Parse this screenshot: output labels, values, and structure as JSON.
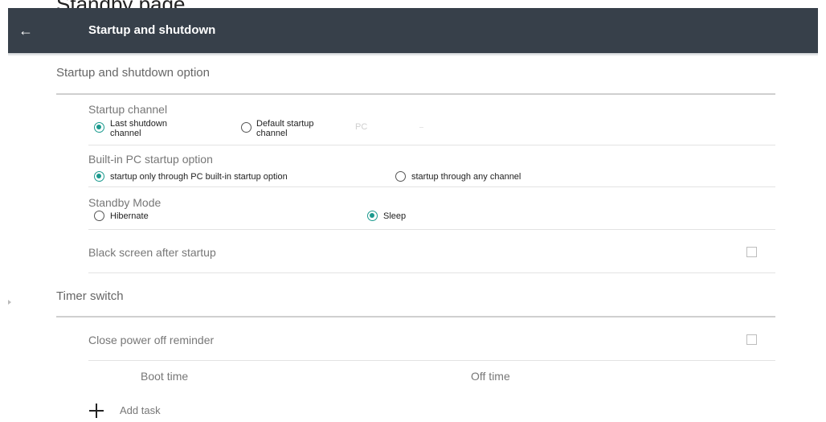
{
  "breadcrumb": "Standby page",
  "header": {
    "title": "Startup and shutdown",
    "back_icon": "arrow-left-icon"
  },
  "section_startup": {
    "title": "Startup and shutdown option"
  },
  "startup_channel": {
    "label": "Startup channel",
    "options": [
      {
        "line1": "Last shutdown",
        "line2": "channel",
        "selected": true
      },
      {
        "line1": "Default startup",
        "line2": "channel",
        "selected": false
      }
    ],
    "default_value": "PC"
  },
  "builtin_pc": {
    "label": "Built-in PC startup option",
    "options": [
      {
        "label": "startup only through PC built-in startup option",
        "selected": true
      },
      {
        "label": "startup through any channel",
        "selected": false
      }
    ]
  },
  "standby_mode": {
    "label": "Standby Mode",
    "options": [
      {
        "label": "Hibernate",
        "selected": false
      },
      {
        "label": "Sleep",
        "selected": true
      }
    ]
  },
  "black_screen": {
    "label": "Black screen after startup",
    "checked": false
  },
  "section_timer": {
    "title": "Timer switch"
  },
  "power_off_reminder": {
    "label": "Close power off reminder",
    "checked": false
  },
  "timer_table": {
    "columns": [
      "Boot time",
      "Off time"
    ]
  },
  "add_task": {
    "label": "Add task",
    "icon": "plus-icon"
  },
  "colors": {
    "header_bg": "#37404a",
    "accent": "#1b9a8e"
  }
}
